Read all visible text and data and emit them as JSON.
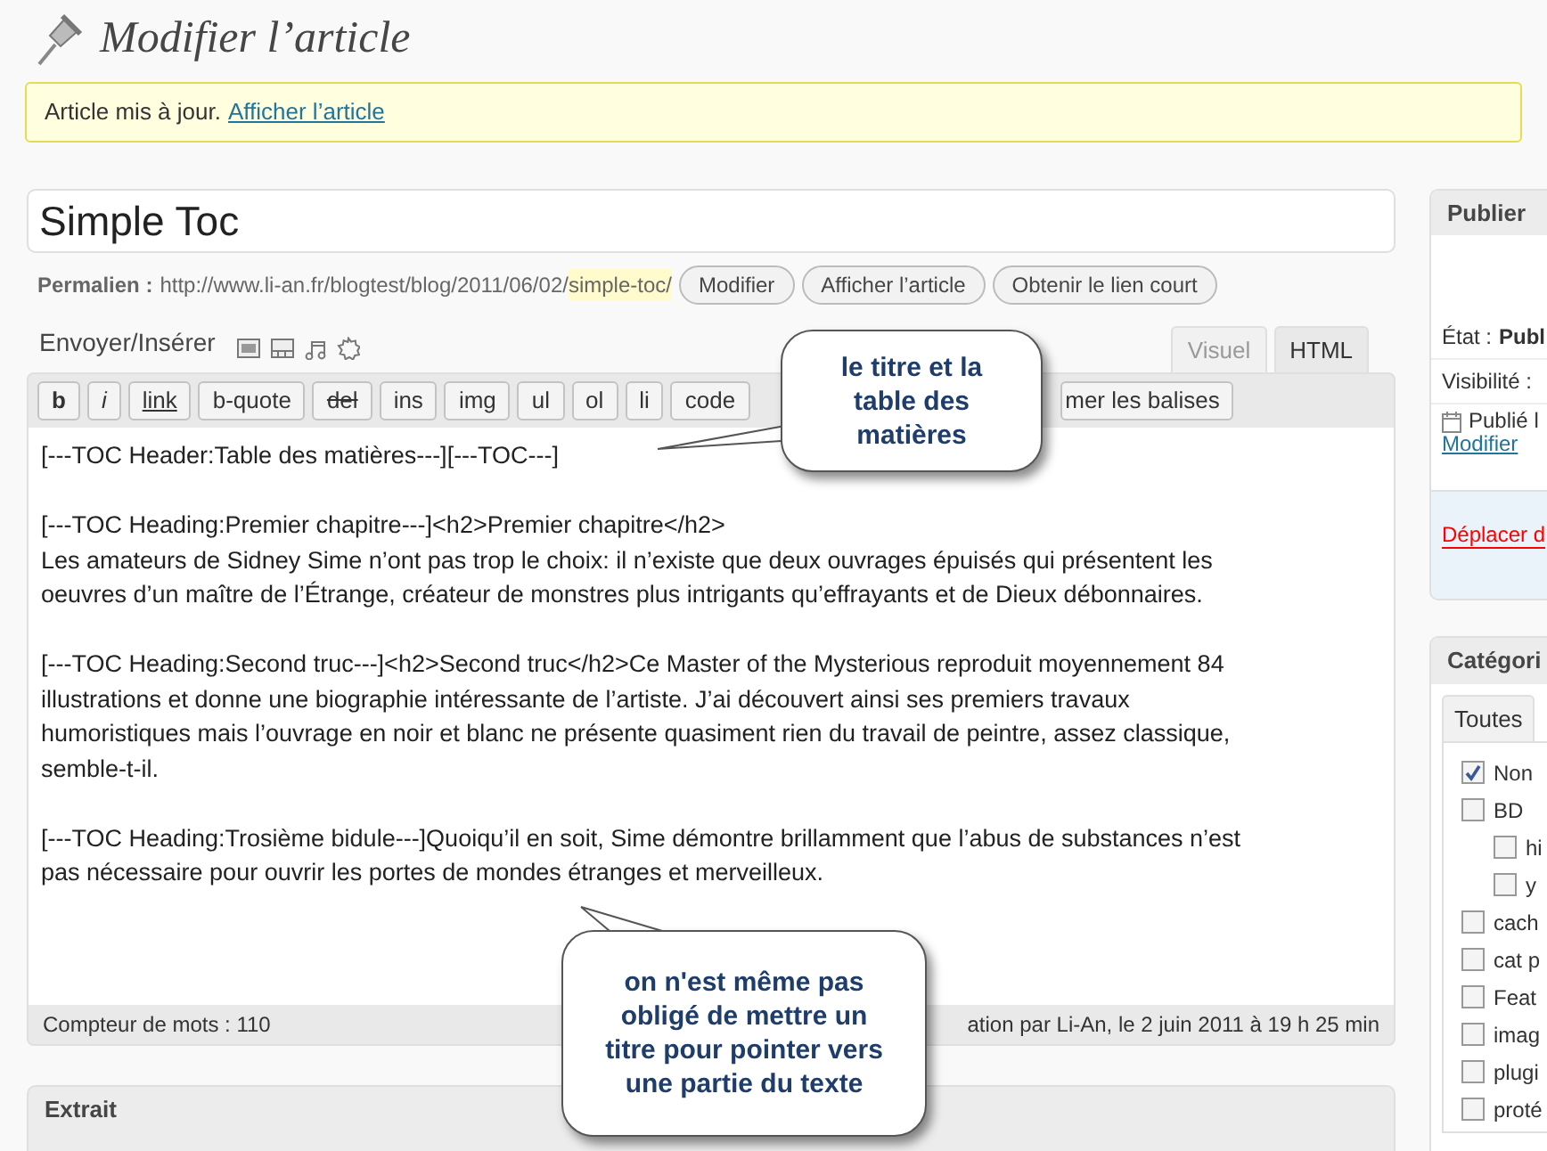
{
  "page_title": "Modifier l’article",
  "notice": {
    "text": "Article mis à jour.",
    "link": "Afficher l’article"
  },
  "post_title": "Simple Toc",
  "permalink": {
    "label": "Permalien :",
    "url": "http://www.li-an.fr/blogtest/blog/2011/06/02/",
    "slug": "simple-toc/",
    "buttons": [
      "Modifier",
      "Afficher l’article",
      "Obtenir le lien court"
    ]
  },
  "media": {
    "label": "Envoyer/Insérer"
  },
  "editor_tabs": [
    {
      "label": "Visuel",
      "selected": false
    },
    {
      "label": "HTML",
      "selected": true
    }
  ],
  "toolbar": [
    {
      "label": "b",
      "kind": "bold"
    },
    {
      "label": "i",
      "kind": "italic"
    },
    {
      "label": "link",
      "kind": "link"
    },
    {
      "label": "b-quote",
      "kind": "plain"
    },
    {
      "label": "del",
      "kind": "strike"
    },
    {
      "label": "ins",
      "kind": "plain"
    },
    {
      "label": "img",
      "kind": "plain"
    },
    {
      "label": "ul",
      "kind": "plain"
    },
    {
      "label": "ol",
      "kind": "plain"
    },
    {
      "label": "li",
      "kind": "plain"
    },
    {
      "label": "code",
      "kind": "plain"
    },
    {
      "label": "mer les balises",
      "kind": "partial"
    }
  ],
  "editor_paragraphs": [
    [
      "[---TOC Header:Table des matières---][---TOC---]"
    ],
    [
      "[---TOC Heading:Premier chapitre---]<h2>Premier chapitre</h2>",
      "Les amateurs de Sidney Sime n’ont pas trop le choix: il n’existe que deux ouvrages épuisés qui présentent les",
      "oeuvres d’un maître de l’Étrange, créateur de monstres plus intrigants qu’effrayants et de Dieux débonnaires."
    ],
    [
      "[---TOC Heading:Second truc---]<h2>Second truc</h2>Ce Master of the Mysterious reproduit moyennement 84",
      "illustrations et donne une biographie intéressante de l’artiste. J’ai découvert ainsi ses premiers travaux",
      "humoristiques mais l’ouvrage en noir et blanc ne présente quasiment rien du travail de peintre, assez classique,",
      "semble-t-il."
    ],
    [
      "[---TOC Heading:Trosième bidule---]Quoiqu’il en soit, Sime démontre brillamment que l’abus de substances n’est",
      "pas nécessaire pour ouvrir les portes de mondes étranges et merveilleux."
    ]
  ],
  "status_bar": {
    "word_count": "Compteur de mots : 110",
    "last_edit": "ation par Li-An, le 2 juin 2011 à 19 h 25 min"
  },
  "excerpt_title": "Extrait",
  "callouts": [
    {
      "text": "le titre et la table des matières"
    },
    {
      "text": "on n'est même pas obligé de mettre un titre pour pointer vers une partie du texte"
    }
  ],
  "publish": {
    "title": "Publier",
    "status_label": "État :",
    "status_value": "Publ",
    "visibility_label": "Visibilité :",
    "published": "Publié l",
    "edit_link": "Modifier",
    "trash_link": "Déplacer d"
  },
  "categories": {
    "title": "Catégori",
    "tab": "Toutes",
    "items": [
      {
        "label": "Non",
        "checked": true
      },
      {
        "label": "BD",
        "checked": false,
        "children": [
          {
            "label": "hi",
            "checked": false
          },
          {
            "label": "y",
            "checked": false
          }
        ]
      },
      {
        "label": "cach",
        "checked": false
      },
      {
        "label": "cat p",
        "checked": false
      },
      {
        "label": "Feat",
        "checked": false
      },
      {
        "label": "imag",
        "checked": false
      },
      {
        "label": "plugi",
        "checked": false
      },
      {
        "label": "proté",
        "checked": false
      }
    ]
  }
}
